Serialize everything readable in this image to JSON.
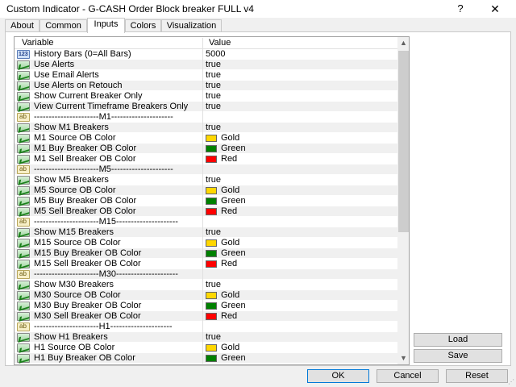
{
  "window": {
    "title": "Custom Indicator - G-CASH Order Block breaker FULL v4",
    "help_label": "?",
    "close_label": "✕"
  },
  "tabs": [
    {
      "label": "About"
    },
    {
      "label": "Common"
    },
    {
      "label": "Inputs",
      "active": true
    },
    {
      "label": "Colors"
    },
    {
      "label": "Visualization"
    }
  ],
  "grid": {
    "header_variable": "Variable",
    "header_value": "Value",
    "rows": [
      {
        "icon": "int",
        "icon_text": "123",
        "name": "History Bars (0=All Bars)",
        "value": "5000"
      },
      {
        "icon": "bool",
        "name": "Use Alerts",
        "value": "true"
      },
      {
        "icon": "bool",
        "name": "Use Email Alerts",
        "value": "true"
      },
      {
        "icon": "bool",
        "name": "Use Alerts on Retouch",
        "value": "true"
      },
      {
        "icon": "bool",
        "name": "Show Current Breaker Only",
        "value": "true"
      },
      {
        "icon": "bool",
        "name": "View Current Timeframe Breakers Only",
        "value": "true"
      },
      {
        "icon": "str",
        "icon_text": "ab",
        "name": "----------------------M1---------------------",
        "value": ""
      },
      {
        "icon": "bool",
        "name": "Show M1 Breakers",
        "value": "true"
      },
      {
        "icon": "color",
        "name": "M1 Source OB Color",
        "value": "Gold",
        "swatch": "#ffd700"
      },
      {
        "icon": "color",
        "name": "M1 Buy Breaker OB Color",
        "value": "Green",
        "swatch": "#008000"
      },
      {
        "icon": "color",
        "name": "M1 Sell Breaker OB Color",
        "value": "Red",
        "swatch": "#ff0000"
      },
      {
        "icon": "str",
        "icon_text": "ab",
        "name": "----------------------M5---------------------",
        "value": ""
      },
      {
        "icon": "bool",
        "name": "Show M5 Breakers",
        "value": "true"
      },
      {
        "icon": "color",
        "name": "M5 Source OB Color",
        "value": "Gold",
        "swatch": "#ffd700"
      },
      {
        "icon": "color",
        "name": "M5 Buy Breaker OB Color",
        "value": "Green",
        "swatch": "#008000"
      },
      {
        "icon": "color",
        "name": "M5 Sell Breaker OB Color",
        "value": "Red",
        "swatch": "#ff0000"
      },
      {
        "icon": "str",
        "icon_text": "ab",
        "name": "----------------------M15---------------------",
        "value": ""
      },
      {
        "icon": "bool",
        "name": "Show M15 Breakers",
        "value": "true"
      },
      {
        "icon": "color",
        "name": "M15 Source OB Color",
        "value": "Gold",
        "swatch": "#ffd700"
      },
      {
        "icon": "color",
        "name": "M15 Buy Breaker OB Color",
        "value": "Green",
        "swatch": "#008000"
      },
      {
        "icon": "color",
        "name": "M15 Sell Breaker OB Color",
        "value": "Red",
        "swatch": "#ff0000"
      },
      {
        "icon": "str",
        "icon_text": "ab",
        "name": "----------------------M30---------------------",
        "value": ""
      },
      {
        "icon": "bool",
        "name": "Show M30 Breakers",
        "value": "true"
      },
      {
        "icon": "color",
        "name": "M30 Source OB Color",
        "value": "Gold",
        "swatch": "#ffd700"
      },
      {
        "icon": "color",
        "name": "M30 Buy Breaker OB Color",
        "value": "Green",
        "swatch": "#008000"
      },
      {
        "icon": "color",
        "name": "M30 Sell Breaker OB Color",
        "value": "Red",
        "swatch": "#ff0000"
      },
      {
        "icon": "str",
        "icon_text": "ab",
        "name": "----------------------H1---------------------",
        "value": ""
      },
      {
        "icon": "bool",
        "name": "Show H1 Breakers",
        "value": "true"
      },
      {
        "icon": "color",
        "name": "H1 Source OB Color",
        "value": "Gold",
        "swatch": "#ffd700"
      },
      {
        "icon": "color",
        "name": "H1 Buy Breaker OB Color",
        "value": "Green",
        "swatch": "#008000"
      }
    ]
  },
  "side_buttons": {
    "load_label": "Load",
    "save_label": "Save"
  },
  "bottom_buttons": {
    "ok_label": "OK",
    "cancel_label": "Cancel",
    "reset_label": "Reset"
  },
  "colors": {
    "gold": "#ffd700",
    "green": "#008000",
    "red": "#ff0000",
    "default_button_border": "#0078d7"
  }
}
